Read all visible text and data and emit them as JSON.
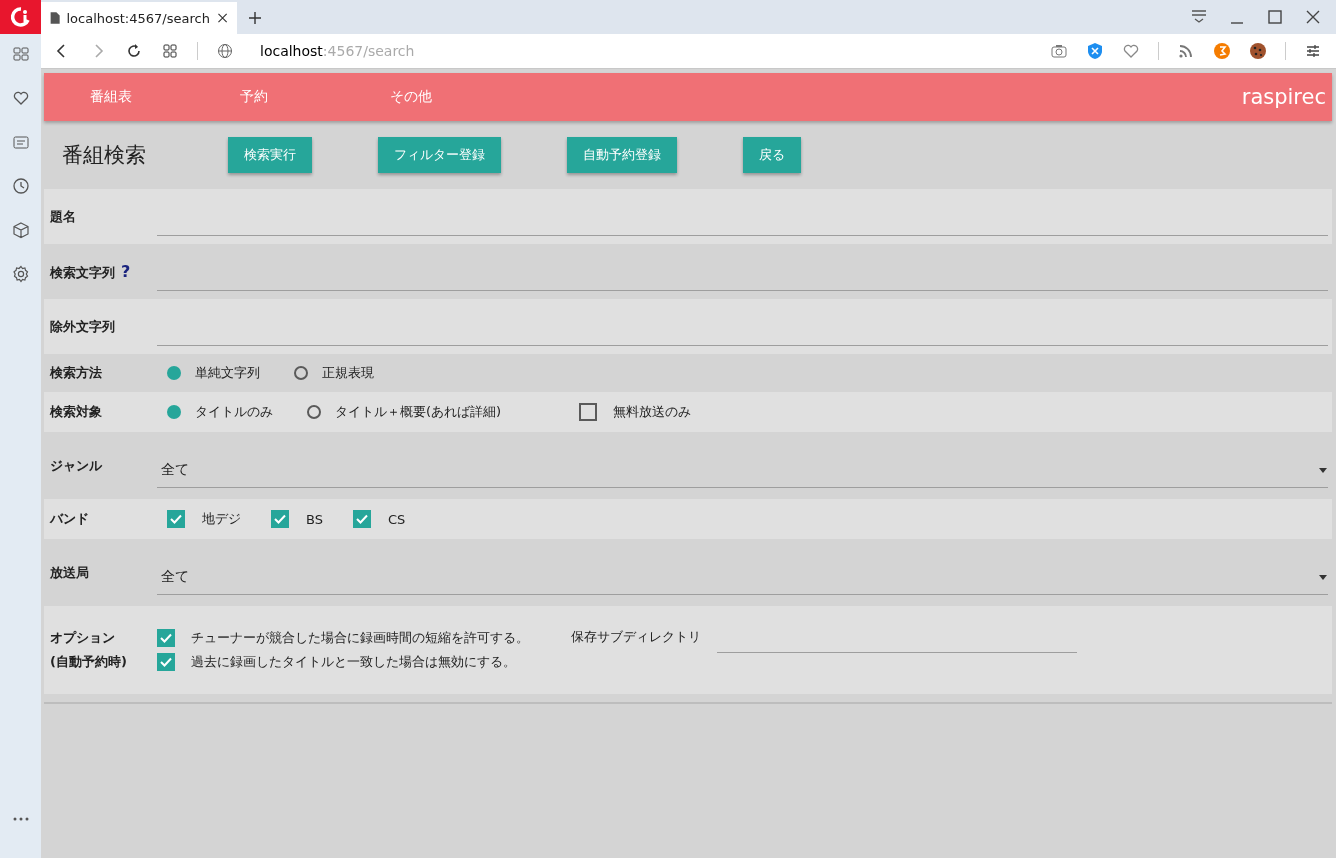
{
  "browser": {
    "tab_title": "localhost:4567/search",
    "url_host": "localhost",
    "url_rest": ":4567/search"
  },
  "nav": {
    "items": [
      "番組表",
      "予約",
      "その他"
    ],
    "brand": "raspirec"
  },
  "page_title": "番組検索",
  "actions": [
    "検索実行",
    "フィルター登録",
    "自動予約登録",
    "戻る"
  ],
  "form": [
    {
      "kind": "text",
      "label": "題名"
    },
    {
      "kind": "text",
      "label": "検索文字列",
      "help": "?"
    },
    {
      "kind": "text",
      "label": "除外文字列"
    },
    {
      "kind": "radio",
      "label": "検索方法",
      "options": [
        {
          "label": "単純文字列",
          "selected": true
        },
        {
          "label": "正規表現",
          "selected": false
        }
      ]
    },
    {
      "kind": "radio",
      "label": "検索対象",
      "options": [
        {
          "label": "タイトルのみ",
          "selected": true
        },
        {
          "label": "タイトル＋概要(あれば詳細)",
          "selected": false
        }
      ],
      "checks": [
        {
          "label": "無料放送のみ",
          "checked": false
        }
      ]
    },
    {
      "kind": "select",
      "label": "ジャンル",
      "value": "全て"
    },
    {
      "kind": "check",
      "label": "バンド",
      "checks": [
        {
          "label": "地デジ",
          "checked": true
        },
        {
          "label": "BS",
          "checked": true
        },
        {
          "label": "CS",
          "checked": true
        }
      ]
    },
    {
      "kind": "select",
      "label": "放送局",
      "value": "全て"
    },
    {
      "kind": "options",
      "label_lines": [
        "オプション",
        "(自動予約時)"
      ],
      "checks": [
        {
          "label": "チューナーが競合した場合に録画時間の短縮を許可する。",
          "checked": true
        },
        {
          "label": "過去に録画したタイトルと一致した場合は無効にする。",
          "checked": true
        }
      ],
      "subdir_label": "保存サブディレクトリ"
    }
  ]
}
